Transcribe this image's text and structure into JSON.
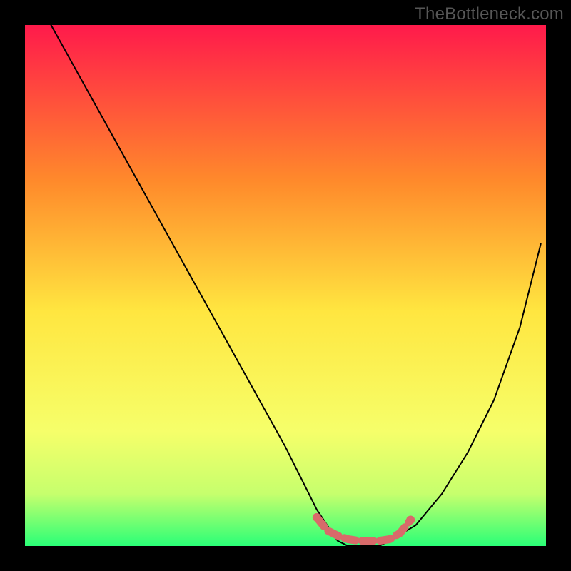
{
  "watermark": "TheBottleneck.com",
  "colors": {
    "frame": "#000000",
    "gradient_top": "#ff1a4b",
    "gradient_mid_upper": "#ff8a2b",
    "gradient_mid": "#ffe640",
    "gradient_mid_lower": "#f6ff6a",
    "gradient_lower": "#c6ff6d",
    "gradient_bottom": "#2aff77",
    "curve": "#000000",
    "marker": "#d86a6a",
    "watermark": "#575757"
  },
  "chart_data": {
    "type": "line",
    "title": "",
    "xlabel": "",
    "ylabel": "",
    "xlim": [
      0,
      100
    ],
    "ylim": [
      0,
      100
    ],
    "grid": false,
    "series": [
      {
        "name": "bottleneck-curve",
        "x": [
          5,
          10,
          15,
          20,
          25,
          30,
          35,
          40,
          45,
          50,
          52,
          54,
          56,
          58,
          60,
          62,
          64,
          66,
          68,
          70,
          75,
          80,
          85,
          90,
          95,
          99
        ],
        "values": [
          100,
          91,
          82,
          73,
          64,
          55,
          46,
          37,
          28,
          19,
          15,
          11,
          7,
          4,
          1,
          0,
          0,
          0,
          0,
          1,
          4,
          10,
          18,
          28,
          42,
          58
        ]
      }
    ],
    "markers": {
      "name": "highlight-band",
      "x": [
        56,
        58,
        60,
        62,
        64,
        66,
        68,
        70,
        72,
        74
      ],
      "values": [
        5.5,
        3,
        2,
        1.3,
        1,
        1,
        1,
        1.3,
        2.5,
        5
      ]
    }
  }
}
